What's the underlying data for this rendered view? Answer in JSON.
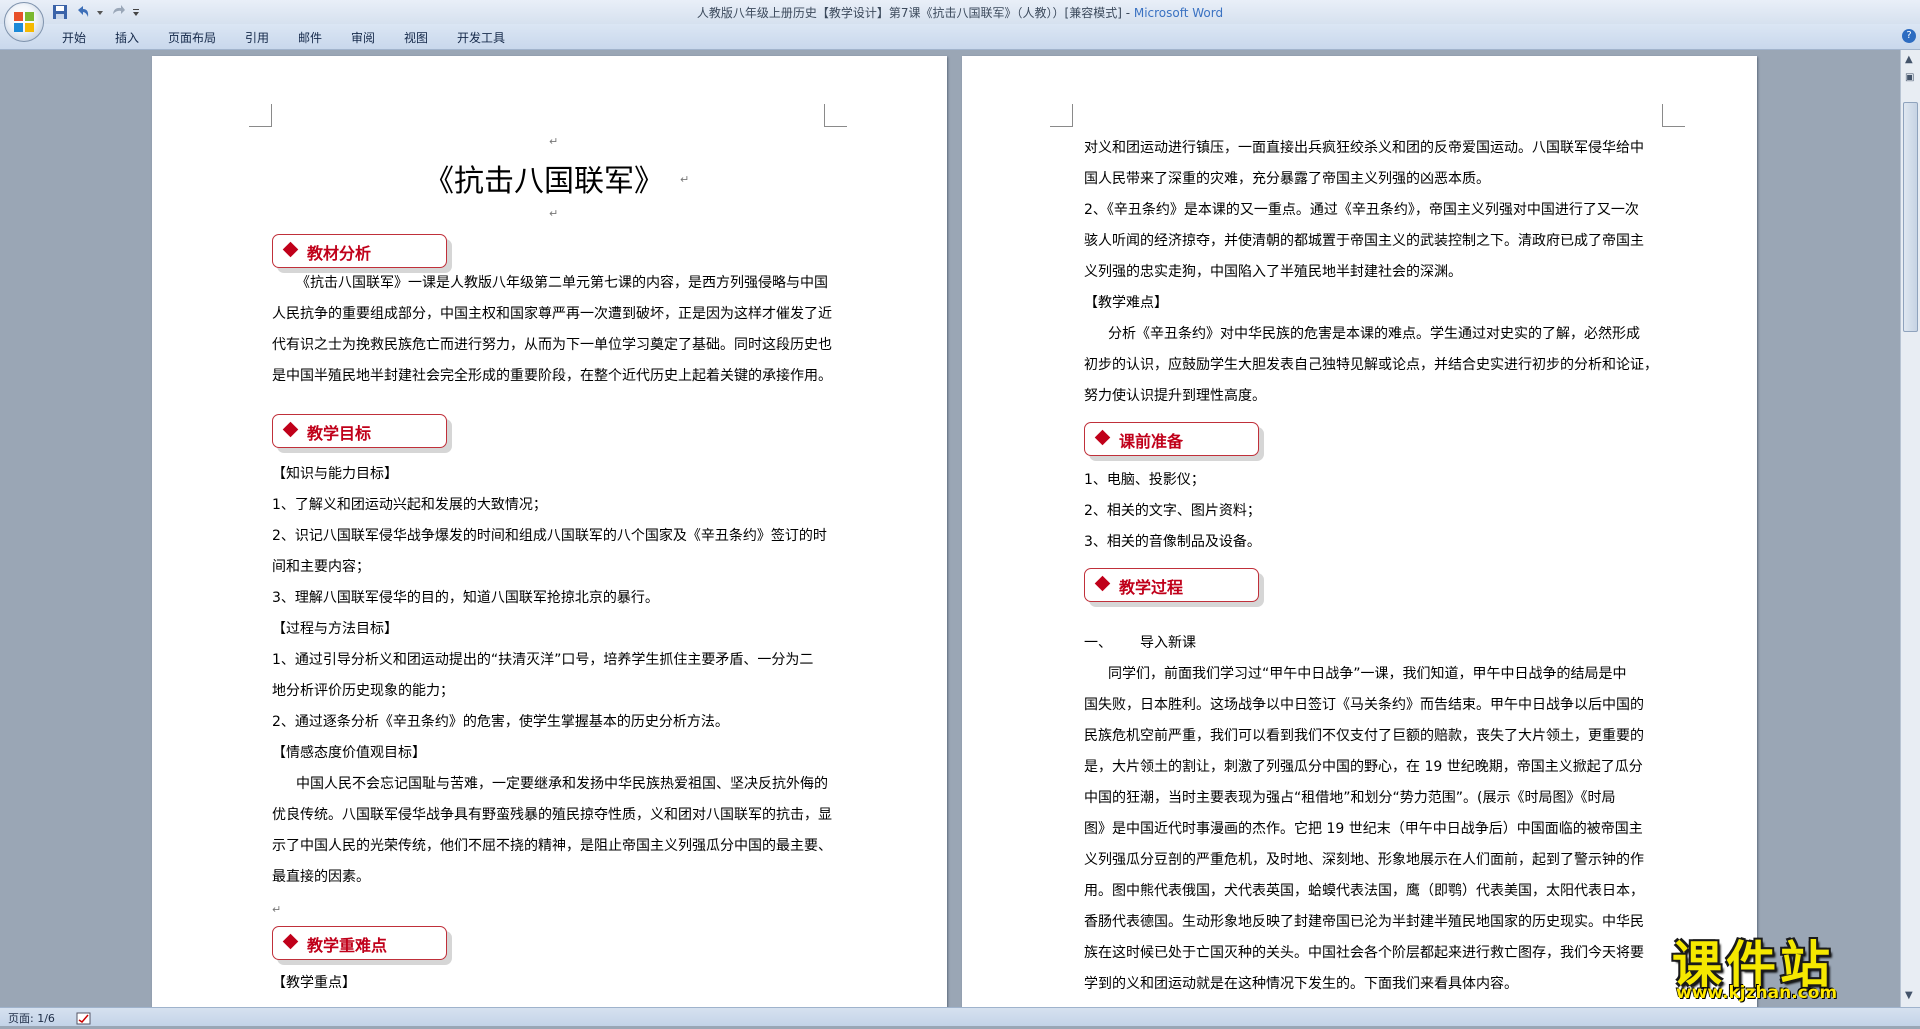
{
  "window": {
    "title_doc": "人教版八年级上册历史【教学设计】第7课《抗击八国联军》（人教））[兼容模式] - ",
    "title_app": "Microsoft Word"
  },
  "ribbon": {
    "tabs": [
      "开始",
      "插入",
      "页面布局",
      "引用",
      "邮件",
      "审阅",
      "视图",
      "开发工具"
    ]
  },
  "page1": {
    "title": "《抗击八国联军》",
    "heading1": "教材分析",
    "para1": [
      "《抗击八国联军》一课是人教版八年级第二单元第七课的内容，是西方列强侵略与中国",
      "人民抗争的重要组成部分，中国主权和国家尊严再一次遭到破坏，正是因为这样才催发了近",
      "代有识之士为挽救民族危亡而进行努力，从而为下一单位学习奠定了基础。同时这段历史也",
      "是中国半殖民地半封建社会完全形成的重要阶段，在整个近代历史上起着关键的承接作用。"
    ],
    "heading2": "教学目标",
    "goals": [
      "【知识与能力目标】",
      "1、了解义和团运动兴起和发展的大致情况；",
      "2、识记八国联军侵华战争爆发的时间和组成八国联军的八个国家及《辛丑条约》签订的时",
      "间和主要内容；",
      "3、理解八国联军侵华的目的，知道八国联军抢掠北京的暴行。",
      "【过程与方法目标】",
      "1、通过引导分析义和团运动提出的“扶清灭洋”口号，培养学生抓住主要矛盾、一分为二",
      "地分析评价历史现象的能力；",
      "2、通过逐条分析《辛丑条约》的危害，使学生掌握基本的历史分析方法。",
      "【情感态度价值观目标】",
      "中国人民不会忘记国耻与苦难，一定要继承和发扬中华民族热爱祖国、坚决反抗外侮的",
      "优良传统。八国联军侵华战争具有野蛮残暴的殖民掠夺性质，义和团对八国联军的抗击，显",
      "示了中国人民的光荣传统，他们不屈不挠的精神，是阻止帝国主义列强瓜分中国的最主要、",
      "最直接的因素。"
    ],
    "heading3": "教学重难点",
    "last_line": "【教学重点】"
  },
  "page2": {
    "lines_a": [
      "对义和团运动进行镇压，一面直接出兵疯狂绞杀义和团的反帝爱国运动。八国联军侵华给中",
      "国人民带来了深重的灾难，充分暴露了帝国主义列强的凶恶本质。",
      "2、《辛丑条约》是本课的又一重点。通过《辛丑条约》，帝国主义列强对中国进行了又一次",
      "骇人听闻的经济掠夺，并使清朝的都城置于帝国主义的武装控制之下。清政府已成了帝国主",
      "义列强的忠实走狗，中国陷入了半殖民地半封建社会的深渊。",
      "【教学难点】",
      "分析《辛丑条约》对中华民族的危害是本课的难点。学生通过对史实的了解，必然形成",
      "初步的认识，应鼓励学生大胆发表自己独特见解或论点，并结合史实进行初步的分析和论证，",
      "努力使认识提升到理性高度。"
    ],
    "heading4": "课前准备",
    "prep": [
      "1、电脑、投影仪；",
      "2、相关的文字、图片资料；",
      "3、相关的音像制品及设备。"
    ],
    "heading5": "教学过程",
    "intro_num": "一、",
    "intro_title": "导入新课",
    "lines_b": [
      "同学们，前面我们学习过“甲午中日战争”一课，我们知道，甲午中日战争的结局是中",
      "国失败，日本胜利。这场战争以中日签订《马关条约》而告结束。甲午中日战争以后中国的",
      "民族危机空前严重，我们可以看到我们不仅支付了巨额的赔款，丧失了大片领土，更重要的",
      "是，大片领土的割让，刺激了列强瓜分中国的野心，在 19 世纪晚期，帝国主义掀起了瓜分",
      "中国的狂潮，当时主要表现为强占“租借地”和划分“势力范围”。(展示《时局图》《时局",
      "图》是中国近代时事漫画的杰作。它把 19 世纪末（甲午中日战争后）中国面临的被帝国主",
      "义列强瓜分豆剖的严重危机，及时地、深刻地、形象地展示在人们面前，起到了警示钟的作",
      "用。图中熊代表俄国，犬代表英国，蛤蟆代表法国，鹰（即鹗）代表美国，太阳代表日本，",
      "香肠代表德国。生动形象地反映了封建帝国已沦为半封建半殖民地国家的历史现实。中华民",
      "族在这时候已处于亡国灭种的关头。中国社会各个阶层都起来进行救亡图存，我们今天将要",
      "学到的义和团运动就是在这种情况下发生的。下面我们来看具体内容。"
    ]
  },
  "status": {
    "page": "页面: 1/6"
  },
  "watermark": {
    "main": "课件站",
    "url": "www.kjzhan.com"
  }
}
